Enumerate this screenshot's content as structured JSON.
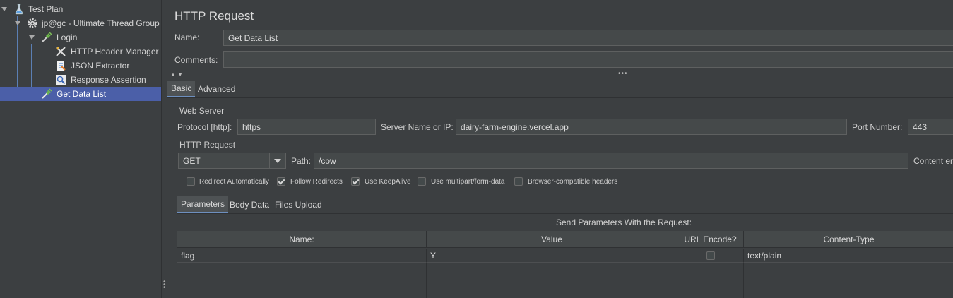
{
  "tree": {
    "items": [
      {
        "label": "Test Plan",
        "icon": "flask-icon"
      },
      {
        "label": "jp@gc - Ultimate Thread Group",
        "icon": "gear-icon"
      },
      {
        "label": "Login",
        "icon": "pipette-icon"
      },
      {
        "label": "HTTP Header Manager",
        "icon": "wrench-icon"
      },
      {
        "label": "JSON Extractor",
        "icon": "json-extractor-icon"
      },
      {
        "label": "Response Assertion",
        "icon": "magnifier-icon"
      },
      {
        "label": "Get Data List",
        "icon": "pipette-icon"
      }
    ],
    "selected": "Get Data List"
  },
  "panel": {
    "title": "HTTP Request",
    "name_label": "Name:",
    "name_value": "Get Data List",
    "comments_label": "Comments:",
    "comments_value": "",
    "tabs": [
      "Basic",
      "Advanced"
    ],
    "web_server": {
      "section_label": "Web Server",
      "protocol_label": "Protocol [http]:",
      "protocol_value": "https",
      "server_label": "Server Name or IP:",
      "server_value": "dairy-farm-engine.vercel.app",
      "port_label": "Port Number:",
      "port_value": "443"
    },
    "http_request": {
      "section_label": "HTTP Request",
      "method": "GET",
      "path_label": "Path:",
      "path_value": "/cow",
      "content_encoding_label": "Content en"
    },
    "options": [
      {
        "label": "Redirect Automatically",
        "checked": false
      },
      {
        "label": "Follow Redirects",
        "checked": true
      },
      {
        "label": "Use KeepAlive",
        "checked": true
      },
      {
        "label": "Use multipart/form-data",
        "checked": false
      },
      {
        "label": "Browser-compatible headers",
        "checked": false
      }
    ],
    "sub_tabs": [
      "Parameters",
      "Body Data",
      "Files Upload"
    ],
    "params": {
      "caption": "Send Parameters With the Request:",
      "columns": [
        "Name:",
        "Value",
        "URL Encode?",
        "Content-Type"
      ],
      "rows": [
        {
          "name": "flag",
          "value": "Y",
          "url_encode": false,
          "content_type": "text/plain"
        }
      ]
    }
  }
}
